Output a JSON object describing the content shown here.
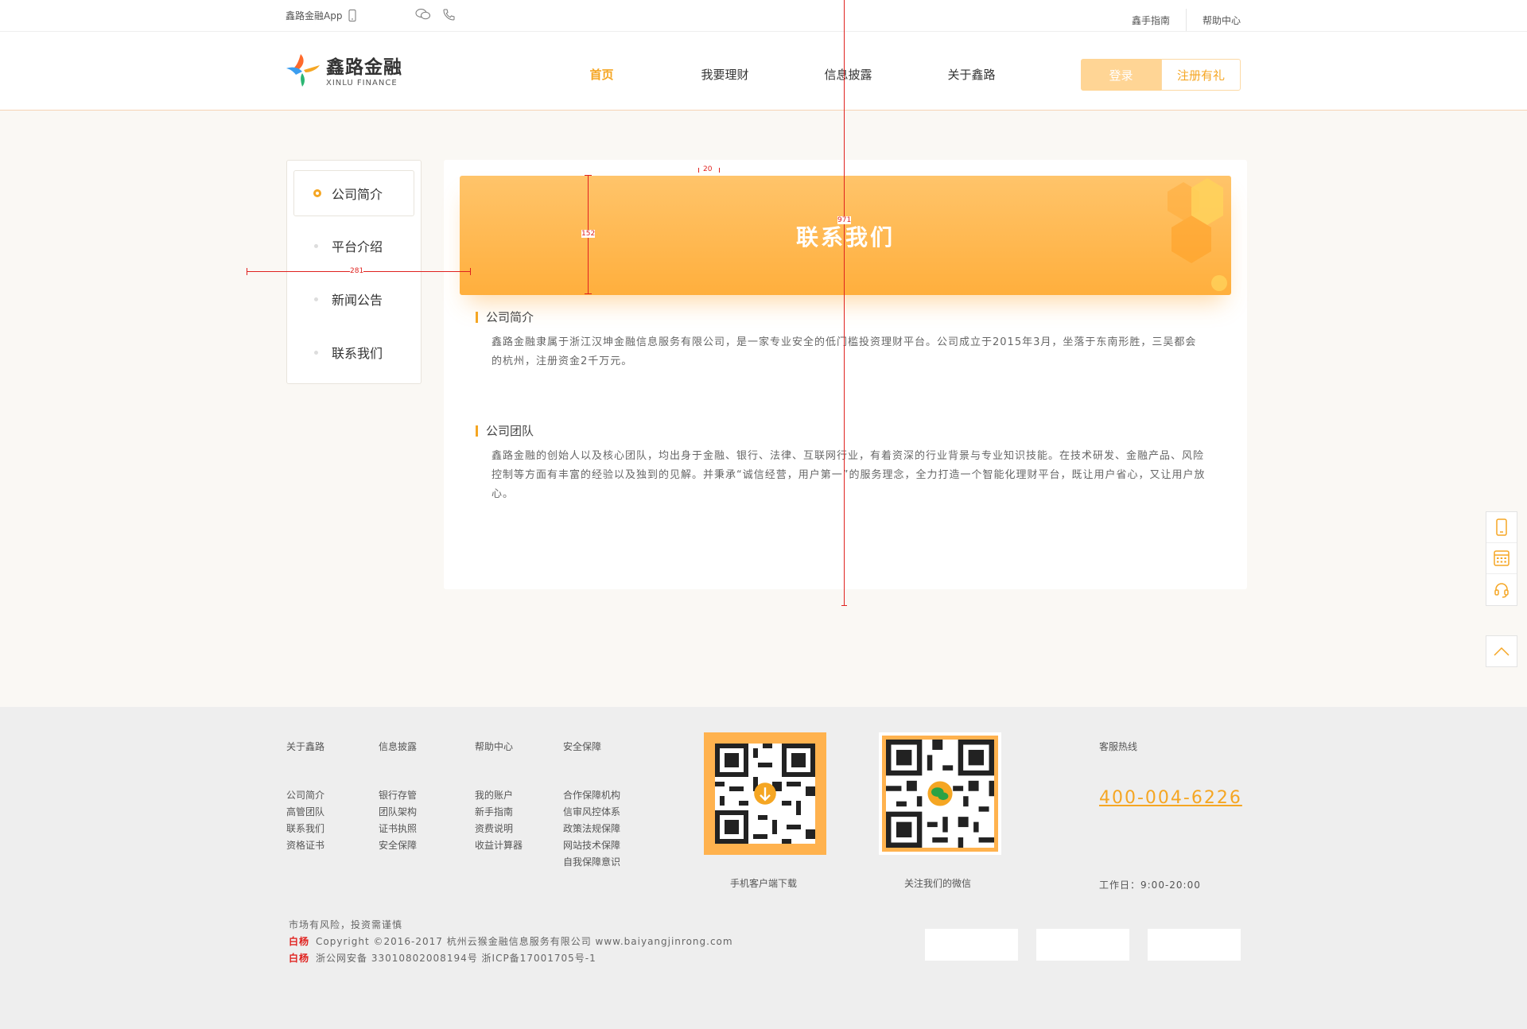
{
  "topbar": {
    "app_label": "鑫路金融App",
    "guide": "鑫手指南",
    "help": "帮助中心"
  },
  "header": {
    "logo_cn": "鑫路金融",
    "logo_en": "XINLU FINANCE",
    "nav": [
      "首页",
      "我要理财",
      "信息披露",
      "关于鑫路"
    ],
    "login": "登录",
    "register": "注册有礼",
    "accent": "#f5a623"
  },
  "sidebar": {
    "items": [
      "公司简介",
      "平台介绍",
      "新闻公告",
      "联系我们"
    ]
  },
  "main": {
    "banner_title": "联系我们",
    "sections": [
      {
        "title": "公司简介",
        "text": "鑫路金融隶属于浙江汉坤金融信息服务有限公司，是一家专业安全的低门槛投资理财平台。公司成立于2015年3月，坐落于东南形胜，三吴都会的杭州，注册资金2千万元。"
      },
      {
        "title": "公司团队",
        "text": "鑫路金融的创始人以及核心团队，均出身于金融、银行、法律、互联网行业，有着资深的行业背景与专业知识技能。在技术研发、金融产品、风险控制等方面有丰富的经验以及独到的见解。并秉承“诚信经营，用户第一”的服务理念，全力打造一个智能化理财平台，既让用户省心，又让用户放心。"
      }
    ]
  },
  "measures": {
    "gap": "20",
    "banner_height": "152",
    "width": "971",
    "offset": "281"
  },
  "footer": {
    "columns": [
      {
        "head": "关于鑫路",
        "links": [
          "公司简介",
          "高管团队",
          "联系我们",
          "资格证书"
        ]
      },
      {
        "head": "信息披露",
        "links": [
          "银行存管",
          "团队架构",
          "证书执照",
          "安全保障"
        ]
      },
      {
        "head": "帮助中心",
        "links": [
          "我的账户",
          "新手指南",
          "资费说明",
          "收益计算器"
        ]
      },
      {
        "head": "安全保障",
        "links": [
          "合作保障机构",
          "信审风控体系",
          "政策法规保障",
          "网站技术保障",
          "自我保障意识"
        ]
      }
    ],
    "qr_app_caption": "手机客户端下载",
    "qr_wechat_caption": "关注我们的微信",
    "hotline_label": "客服热线",
    "hotline": "400-004-6226",
    "hours": "工作日：9:00-20:00",
    "risk": "市场有风险，投资需谨慎",
    "brand": "白杨",
    "copyright": "Copyright ©2016-2017 杭州云猴金融信息服务有限公司 www.baiyangjinrong.com",
    "icp": "浙公网安备 33010802008194号 浙ICP备17001705号-1"
  }
}
